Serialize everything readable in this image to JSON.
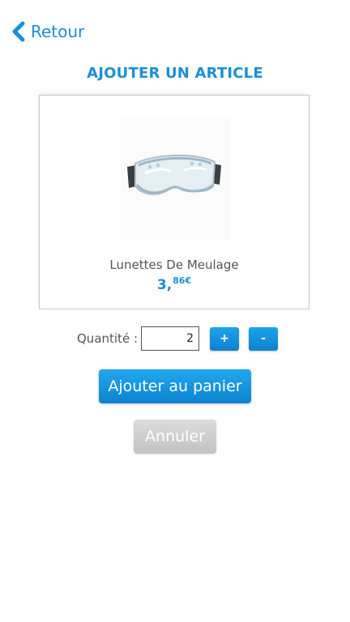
{
  "header": {
    "back_label": "Retour",
    "title": "AJOUTER UN ARTICLE"
  },
  "product": {
    "name": "Lunettes De Meulage",
    "price_int": "3,",
    "price_dec": "86€",
    "image_icon": "safety-goggles-icon"
  },
  "quantity": {
    "label": "Quantité :",
    "value": "2",
    "plus_label": "+",
    "minus_label": "-"
  },
  "actions": {
    "add_label": "Ajouter au panier",
    "cancel_label": "Annuler"
  },
  "colors": {
    "accent": "#1a8fd6",
    "disabled": "#c8c8c8"
  }
}
